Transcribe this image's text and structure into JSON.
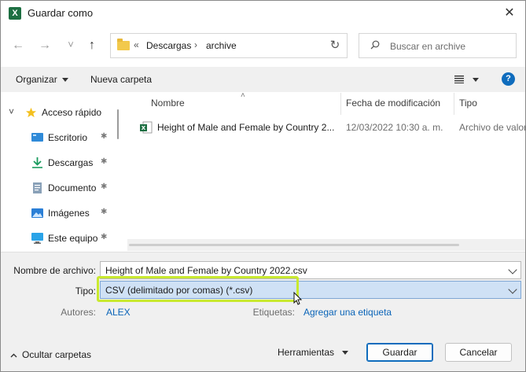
{
  "window": {
    "title": "Guardar como",
    "app_icon_letter": "X",
    "close_glyph": "✕"
  },
  "nav": {
    "back_glyph": "←",
    "forward_glyph": "→",
    "recent_glyph": "˅",
    "up_glyph": "↑"
  },
  "address": {
    "overflow": "«",
    "crumbs": [
      "Descargas",
      "archive"
    ],
    "sep": "›",
    "refresh_glyph": "↻"
  },
  "search": {
    "placeholder": "Buscar en archive"
  },
  "toolbar": {
    "organize_label": "Organizar",
    "new_folder_label": "Nueva carpeta",
    "help_glyph": "?"
  },
  "sidebar": {
    "items": [
      {
        "label": "Acceso rápido",
        "icon": "star-icon"
      },
      {
        "label": "Escritorio",
        "icon": "desktop-icon"
      },
      {
        "label": "Descargas",
        "icon": "download-icon"
      },
      {
        "label": "Documento",
        "icon": "document-icon"
      },
      {
        "label": "Imágenes",
        "icon": "images-icon"
      },
      {
        "label": "Este equipo",
        "icon": "computer-icon"
      }
    ],
    "pin_glyph": "✱",
    "expand_glyph": "˅"
  },
  "filelist": {
    "columns": [
      "Nombre",
      "Fecha de modificación",
      "Tipo"
    ],
    "sort_glyph": "˄",
    "rows": [
      {
        "name": "Height of Male and Female by Country 2...",
        "date": "12/03/2022 10:30 a. m.",
        "type": "Archivo de valor"
      }
    ]
  },
  "form": {
    "filename_label": "Nombre de archivo:",
    "filename_value": "Height of Male and Female by Country 2022.csv",
    "type_label": "Tipo:",
    "type_value": "CSV (delimitado por comas) (*.csv)",
    "authors_label": "Autores:",
    "authors_value": "ALEX",
    "tags_label": "Etiquetas:",
    "tags_value": "Agregar una etiqueta"
  },
  "footer": {
    "hide_folders_label": "Ocultar carpetas",
    "tools_label": "Herramientas",
    "save_label": "Guardar",
    "cancel_label": "Cancelar"
  },
  "colors": {
    "accent": "#0f6cbd",
    "highlight_outline": "#c9e92f",
    "excel_green": "#1d6f42"
  }
}
